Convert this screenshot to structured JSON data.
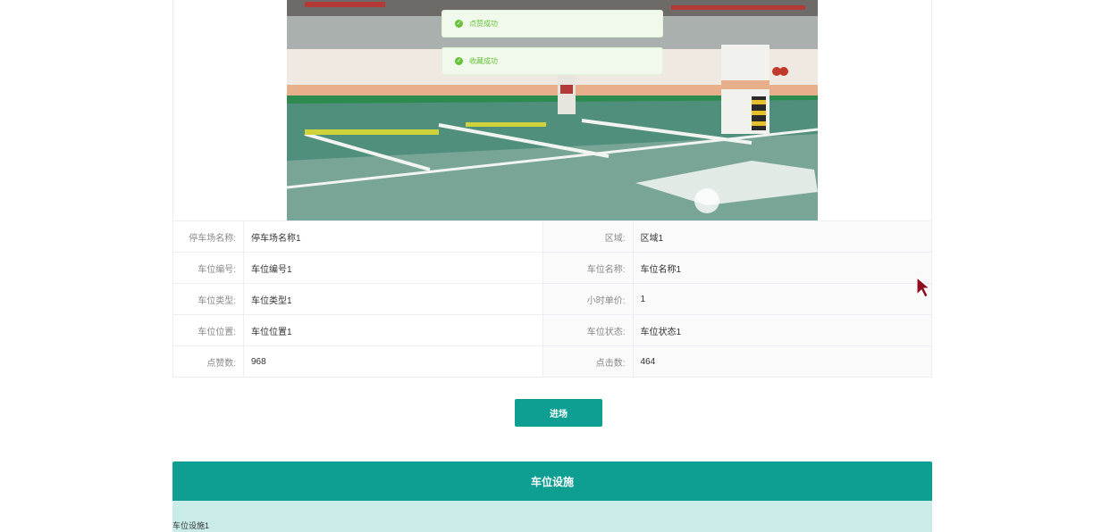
{
  "toasts": [
    {
      "icon": "success-check-icon",
      "text": "点赞成功"
    },
    {
      "icon": "success-check-icon",
      "text": "收藏成功"
    }
  ],
  "details": {
    "rows": [
      {
        "l1": "停车场名称:",
        "v1": "停车场名称1",
        "l2": "区域:",
        "v2": "区域1"
      },
      {
        "l1": "车位编号:",
        "v1": "车位编号1",
        "l2": "车位名称:",
        "v2": "车位名称1"
      },
      {
        "l1": "车位类型:",
        "v1": "车位类型1",
        "l2": "小时单价:",
        "v2": "1"
      },
      {
        "l1": "车位位置:",
        "v1": "车位位置1",
        "l2": "车位状态:",
        "v2": "车位状态1"
      },
      {
        "l1": "点赞数:",
        "v1": "968",
        "l2": "点击数:",
        "v2": "464"
      }
    ]
  },
  "actions": {
    "enter_label": "进场"
  },
  "facilities": {
    "title": "车位设施",
    "content": "车位设施1"
  },
  "colors": {
    "primary": "#0e9e92",
    "success": "#67c23a",
    "panel_body": "#c9ece9"
  }
}
